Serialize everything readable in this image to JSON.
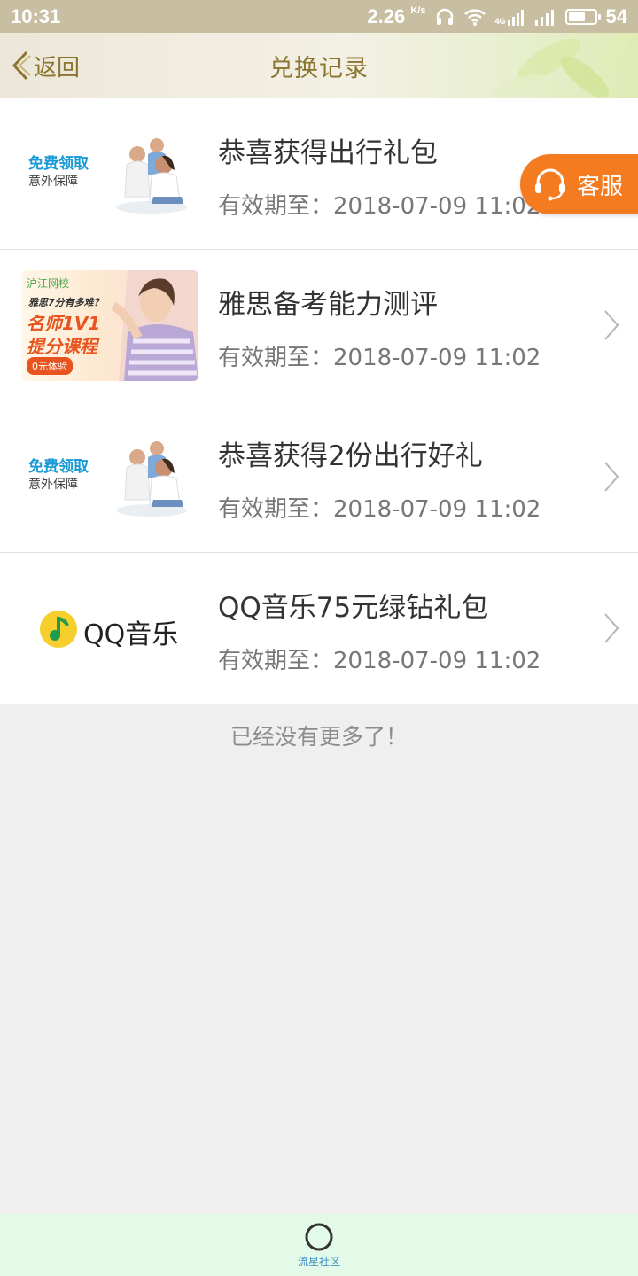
{
  "status_bar": {
    "time": "10:31",
    "speed": "2.26",
    "speed_unit": "K/s",
    "network": "4G",
    "battery": "54"
  },
  "header": {
    "back_label": "返回",
    "title": "兑换记录",
    "accent_color": "#8b7530"
  },
  "service_button": {
    "label": "客服",
    "icon": "headset-icon",
    "color": "#f47b1f"
  },
  "records": [
    {
      "title": "恭喜获得出行礼包",
      "date_prefix": "有效期至：",
      "date": "2018-07-09 11:02",
      "thumb": {
        "line1": "免费领取",
        "line2": "意外保障"
      }
    },
    {
      "title": "雅思备考能力测评",
      "date_prefix": "有效期至：",
      "date": "2018-07-09 11:02",
      "thumb": {
        "brand": "沪江网校",
        "question": "雅思7分有多难？",
        "line1": "名师1V1",
        "line2": "提分课程",
        "button": "0元体验"
      }
    },
    {
      "title": "恭喜获得2份出行好礼",
      "date_prefix": "有效期至：",
      "date": "2018-07-09 11:02",
      "thumb": {
        "line1": "免费领取",
        "line2": "意外保障"
      }
    },
    {
      "title": "QQ音乐75元绿钻礼包",
      "date_prefix": "有效期至：",
      "date": "2018-07-09 11:02",
      "thumb": {
        "brand": "QQ音乐"
      }
    }
  ],
  "footer_note": "已经没有更多了！",
  "bottom_nav": {
    "label": "流星社区",
    "icon": "circle-icon"
  }
}
